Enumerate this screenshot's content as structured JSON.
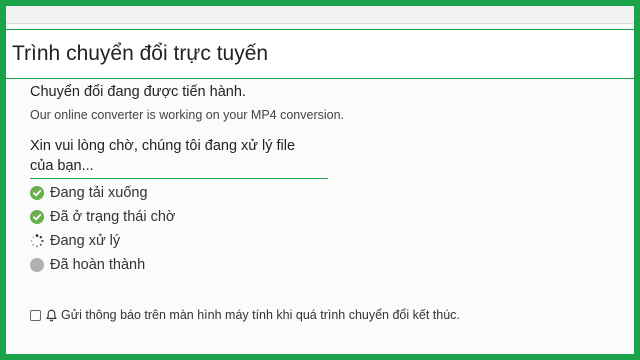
{
  "page": {
    "title": "Trình chuyển đổi trực tuyến"
  },
  "status": {
    "heading": "Chuyển đổi đang được tiến hành.",
    "subtext": "Our online converter is working on your MP4 conversion."
  },
  "wait": {
    "line1": "Xin vui lòng chờ, chúng tôi đang xử lý file",
    "line2": "của bạn..."
  },
  "steps": [
    {
      "label": "Đang tải xuống",
      "state": "done",
      "icon": "check-circle-icon"
    },
    {
      "label": "Đã ở trạng thái chờ",
      "state": "done",
      "icon": "check-circle-icon"
    },
    {
      "label": "Đang xử lý",
      "state": "in-progress",
      "icon": "spinner-icon"
    },
    {
      "label": "Đã hoàn thành",
      "state": "pending",
      "icon": "grey-circle-icon"
    }
  ],
  "notify": {
    "label": "Gửi thông báo trên màn hình máy tính khi quá trình chuyển đổi kết thúc.",
    "checked": false,
    "icon": "bell-icon"
  },
  "colors": {
    "accent": "#1aa34a",
    "check": "#6ab04c",
    "pending": "#b0b0b0"
  }
}
